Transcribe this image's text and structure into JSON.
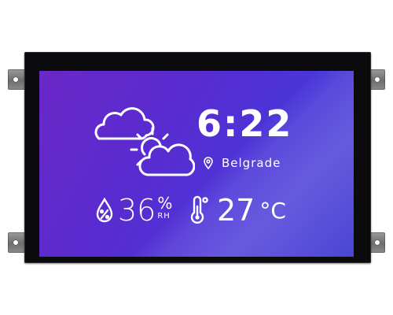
{
  "display": {
    "time": "6:22",
    "location": "Belgrade",
    "humidity": {
      "value": "36",
      "symbol": "%",
      "unit": "RH"
    },
    "temperature": {
      "value": "27",
      "unit": "°C"
    },
    "icons": {
      "weather": "cloud-sun-icon",
      "location": "map-pin-icon",
      "humidity": "humidity-drop-icon",
      "temperature": "thermometer-icon"
    },
    "colors": {
      "screen_start": "#6a28c8",
      "screen_end": "#3e3ad2",
      "text": "#ffffff",
      "bezel": "#0b0b0d"
    }
  }
}
